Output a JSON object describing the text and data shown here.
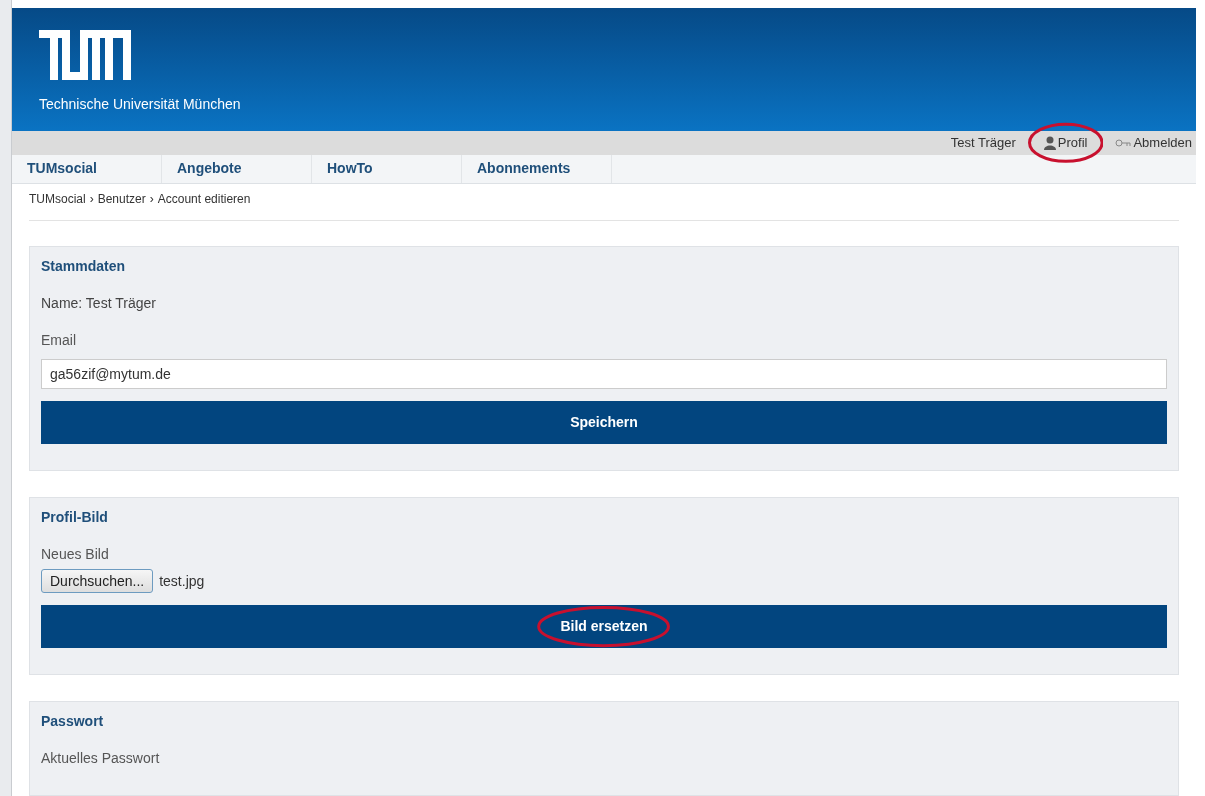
{
  "header": {
    "subtitle": "Technische Universität München"
  },
  "user_bar": {
    "user_name": "Test Träger",
    "links": [
      {
        "kind": "profile",
        "label": "Profil",
        "highlighted": true
      },
      {
        "kind": "logout",
        "label": "Abmelden",
        "highlighted": false
      }
    ]
  },
  "nav": [
    {
      "label": "TUMsocial"
    },
    {
      "label": "Angebote"
    },
    {
      "label": "HowTo"
    },
    {
      "label": "Abonnements"
    }
  ],
  "breadcrumb": {
    "separator": "›",
    "items": [
      "TUMsocial",
      "Benutzer",
      "Account editieren"
    ]
  },
  "sections": [
    {
      "title": "Stammdaten",
      "rows": [
        {
          "kind": "text",
          "text": "Name: Test Träger"
        },
        {
          "kind": "label",
          "text": "Email"
        },
        {
          "kind": "input",
          "value": "ga56zif@mytum.de"
        },
        {
          "kind": "submit",
          "label": "Speichern",
          "highlighted": false
        }
      ]
    },
    {
      "title": "Profil-Bild",
      "rows": [
        {
          "kind": "label",
          "text": "Neues Bild"
        },
        {
          "kind": "file",
          "button": "Durchsuchen...",
          "file_name": "test.jpg"
        },
        {
          "kind": "submit",
          "label": "Bild ersetzen",
          "highlighted": true
        }
      ]
    },
    {
      "title": "Passwort",
      "rows": [
        {
          "kind": "label",
          "text": "Aktuelles Passwort"
        }
      ]
    }
  ]
}
